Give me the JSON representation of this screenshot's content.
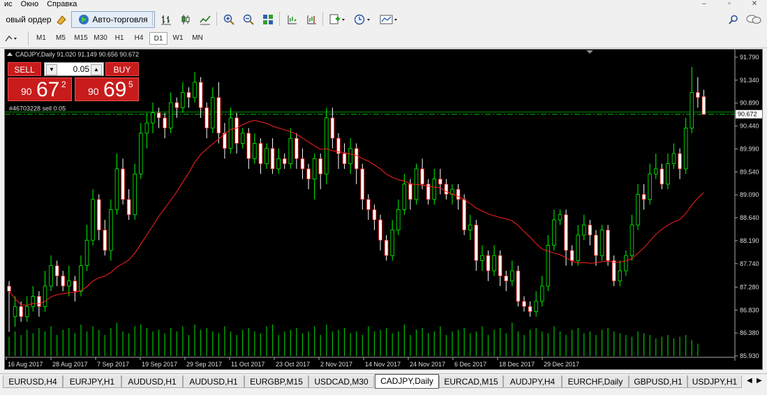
{
  "menu": {
    "items": [
      "ис",
      "Окно",
      "Справка"
    ],
    "win_min": "–",
    "win_restore": "▫",
    "win_close": "✕"
  },
  "toolbar": {
    "new_order_label": "овый ордер",
    "auto_trading_label": "Авто-торговля",
    "timeframes": [
      "M1",
      "M5",
      "M15",
      "M30",
      "H1",
      "H4",
      "D1",
      "W1",
      "MN"
    ],
    "active_timeframe": "D1"
  },
  "chart": {
    "header": "CADJPY,Daily  91.020 91.149 90.656 90.672",
    "order_label": "#46703228 sell 0.05",
    "current_price": "90.672",
    "one_click": {
      "sell_label": "SELL",
      "buy_label": "BUY",
      "lot": "0.05",
      "sell_small": "90",
      "sell_big": "67",
      "sell_sup": "2",
      "buy_small": "90",
      "buy_big": "69",
      "buy_sup": "5"
    }
  },
  "chart_data": {
    "type": "candlestick",
    "symbol": "CADJPY",
    "timeframe": "Daily",
    "price_axis": [
      "91.790",
      "91.340",
      "90.890",
      "90.440",
      "89.990",
      "89.540",
      "89.090",
      "88.640",
      "88.190",
      "87.740",
      "87.280",
      "86.830",
      "86.380",
      "85.930"
    ],
    "ylim": [
      85.93,
      91.79
    ],
    "x_labels": [
      "16 Aug 2017",
      "28 Aug 2017",
      "7 Sep 2017",
      "19 Sep 2017",
      "29 Sep 2017",
      "11 Oct 2017",
      "23 Oct 2017",
      "2 Nov 2017",
      "14 Nov 2017",
      "24 Nov 2017",
      "6 Dec 2017",
      "18 Dec 2017",
      "29 Dec 2017"
    ],
    "current_price": 90.672,
    "order_price": 90.672,
    "candles": [
      [
        87.3,
        87.2,
        87.4,
        86.4
      ],
      [
        86.7,
        86.9,
        87.1,
        86.5
      ],
      [
        86.9,
        86.7,
        87.0,
        86.6
      ],
      [
        86.7,
        86.9,
        87.1,
        86.6
      ],
      [
        86.9,
        87.1,
        87.3,
        86.8
      ],
      [
        87.1,
        86.9,
        87.2,
        86.7
      ],
      [
        86.9,
        87.3,
        87.6,
        86.8
      ],
      [
        87.3,
        87.7,
        87.9,
        87.2
      ],
      [
        87.7,
        87.5,
        87.8,
        87.3
      ],
      [
        87.5,
        87.3,
        87.6,
        87.2
      ],
      [
        87.3,
        87.4,
        87.7,
        87.1
      ],
      [
        87.4,
        87.2,
        87.5,
        87.0
      ],
      [
        87.2,
        87.7,
        87.9,
        87.1
      ],
      [
        87.7,
        88.2,
        88.5,
        87.6
      ],
      [
        88.2,
        89.0,
        89.2,
        88.1
      ],
      [
        89.0,
        88.4,
        89.1,
        88.2
      ],
      [
        88.4,
        88.0,
        88.6,
        87.9
      ],
      [
        88.0,
        88.8,
        89.0,
        87.8
      ],
      [
        88.8,
        89.6,
        89.9,
        88.7
      ],
      [
        89.6,
        89.0,
        89.8,
        88.9
      ],
      [
        89.0,
        88.7,
        89.2,
        88.6
      ],
      [
        88.7,
        89.5,
        89.7,
        88.6
      ],
      [
        89.5,
        90.3,
        90.5,
        89.4
      ],
      [
        90.3,
        90.5,
        90.7,
        90.0
      ],
      [
        90.5,
        90.7,
        90.9,
        90.3
      ],
      [
        90.7,
        90.6,
        90.8,
        90.4
      ],
      [
        90.6,
        90.4,
        90.7,
        90.2
      ],
      [
        90.4,
        90.9,
        91.1,
        90.3
      ],
      [
        90.9,
        90.8,
        91.0,
        90.6
      ],
      [
        90.8,
        91.1,
        91.3,
        90.7
      ],
      [
        91.1,
        91.0,
        91.2,
        90.8
      ],
      [
        91.0,
        91.3,
        91.5,
        90.9
      ],
      [
        91.3,
        90.8,
        91.4,
        90.6
      ],
      [
        90.8,
        90.4,
        90.9,
        90.2
      ],
      [
        90.4,
        91.0,
        91.2,
        90.3
      ],
      [
        91.0,
        90.3,
        91.3,
        90.1
      ],
      [
        90.3,
        90.0,
        90.5,
        89.8
      ],
      [
        90.0,
        90.6,
        90.8,
        89.9
      ],
      [
        90.6,
        90.1,
        90.7,
        89.9
      ],
      [
        90.1,
        90.3,
        90.4,
        90.0
      ],
      [
        90.3,
        89.8,
        90.4,
        89.6
      ],
      [
        89.8,
        90.1,
        90.3,
        89.7
      ],
      [
        90.1,
        89.7,
        90.2,
        89.5
      ],
      [
        89.7,
        90.0,
        90.1,
        89.6
      ],
      [
        90.0,
        89.6,
        90.2,
        89.5
      ],
      [
        89.6,
        89.8,
        90.0,
        89.5
      ],
      [
        89.8,
        89.7,
        89.9,
        89.6
      ],
      [
        89.7,
        90.2,
        90.4,
        89.6
      ],
      [
        90.2,
        89.8,
        90.3,
        89.6
      ],
      [
        89.8,
        89.6,
        90.0,
        89.4
      ],
      [
        89.6,
        89.4,
        89.7,
        89.2
      ],
      [
        89.4,
        89.8,
        89.9,
        89.0
      ],
      [
        89.8,
        89.5,
        89.9,
        89.2
      ],
      [
        89.5,
        90.6,
        90.8,
        89.3
      ],
      [
        90.6,
        90.2,
        90.8,
        90.0
      ],
      [
        90.2,
        89.9,
        90.3,
        89.6
      ],
      [
        89.9,
        89.7,
        90.1,
        89.6
      ],
      [
        89.7,
        90.0,
        90.2,
        89.5
      ],
      [
        90.0,
        89.6,
        90.1,
        89.3
      ],
      [
        89.6,
        89.0,
        89.7,
        88.8
      ],
      [
        89.0,
        88.8,
        89.1,
        88.6
      ],
      [
        88.8,
        88.6,
        88.9,
        88.4
      ],
      [
        88.6,
        88.2,
        88.7,
        88.0
      ],
      [
        88.2,
        87.9,
        88.3,
        87.8
      ],
      [
        87.9,
        88.4,
        88.6,
        87.8
      ],
      [
        88.4,
        88.8,
        89.0,
        88.3
      ],
      [
        88.8,
        89.3,
        89.5,
        88.7
      ],
      [
        89.3,
        89.0,
        89.4,
        88.8
      ],
      [
        89.0,
        89.6,
        89.7,
        88.9
      ],
      [
        89.6,
        89.3,
        89.8,
        89.2
      ],
      [
        89.3,
        89.0,
        89.4,
        88.9
      ],
      [
        89.0,
        89.4,
        89.6,
        88.9
      ],
      [
        89.4,
        89.3,
        89.6,
        89.1
      ],
      [
        89.3,
        89.1,
        89.4,
        89.0
      ],
      [
        89.1,
        89.2,
        89.3,
        88.9
      ],
      [
        89.2,
        89.0,
        89.3,
        88.8
      ],
      [
        89.0,
        88.4,
        89.1,
        88.3
      ],
      [
        88.4,
        88.5,
        88.7,
        88.2
      ],
      [
        88.5,
        87.8,
        88.6,
        87.6
      ],
      [
        87.8,
        87.9,
        88.1,
        87.6
      ],
      [
        87.9,
        87.6,
        88.0,
        87.4
      ],
      [
        87.6,
        87.9,
        88.1,
        87.5
      ],
      [
        87.9,
        87.5,
        88.0,
        87.3
      ],
      [
        87.5,
        87.4,
        87.6,
        87.2
      ],
      [
        87.4,
        87.6,
        87.8,
        87.3
      ],
      [
        87.6,
        87.0,
        87.7,
        86.9
      ],
      [
        87.0,
        86.9,
        87.1,
        86.8
      ],
      [
        86.9,
        86.8,
        87.0,
        86.7
      ],
      [
        86.8,
        87.0,
        87.2,
        86.7
      ],
      [
        87.0,
        87.3,
        87.5,
        86.9
      ],
      [
        87.3,
        88.1,
        88.3,
        87.2
      ],
      [
        88.1,
        88.6,
        88.8,
        88.0
      ],
      [
        88.6,
        88.7,
        88.8,
        88.5
      ],
      [
        88.7,
        88.0,
        88.8,
        87.7
      ],
      [
        88.0,
        87.8,
        88.1,
        87.7
      ],
      [
        87.8,
        88.3,
        88.5,
        87.7
      ],
      [
        88.3,
        88.5,
        88.7,
        88.2
      ],
      [
        88.5,
        88.3,
        88.6,
        88.1
      ],
      [
        88.3,
        87.9,
        88.4,
        87.7
      ],
      [
        87.9,
        88.4,
        88.5,
        87.8
      ],
      [
        88.4,
        87.8,
        88.5,
        87.7
      ],
      [
        87.8,
        87.4,
        87.9,
        87.3
      ],
      [
        87.4,
        87.6,
        87.8,
        87.3
      ],
      [
        87.6,
        87.9,
        88.0,
        87.5
      ],
      [
        87.9,
        88.5,
        88.7,
        87.8
      ],
      [
        88.5,
        89.1,
        89.3,
        88.4
      ],
      [
        89.1,
        89.0,
        89.3,
        88.8
      ],
      [
        89.0,
        89.5,
        89.7,
        88.9
      ],
      [
        89.5,
        89.6,
        89.9,
        89.4
      ],
      [
        89.6,
        89.3,
        89.7,
        89.2
      ],
      [
        89.3,
        89.7,
        89.9,
        89.2
      ],
      [
        89.7,
        89.9,
        90.1,
        89.6
      ],
      [
        89.9,
        89.6,
        90.0,
        89.4
      ],
      [
        89.6,
        90.4,
        90.6,
        89.5
      ],
      [
        90.4,
        91.1,
        91.6,
        90.3
      ],
      [
        91.1,
        91.0,
        91.4,
        90.8
      ],
      [
        91.02,
        90.67,
        91.15,
        90.66
      ]
    ],
    "volumes": [
      0.55,
      0.7,
      0.6,
      0.75,
      0.65,
      0.8,
      0.7,
      0.85,
      0.6,
      0.75,
      0.8,
      0.65,
      0.9,
      0.7,
      0.85,
      0.75,
      0.6,
      0.8,
      0.95,
      0.7,
      0.65,
      0.85,
      0.9,
      0.8,
      0.7,
      0.75,
      0.65,
      0.8,
      0.7,
      0.85,
      0.6,
      0.9,
      0.75,
      0.8,
      0.7,
      0.65,
      0.85,
      0.7,
      0.6,
      0.75,
      0.8,
      0.7,
      0.65,
      0.85,
      0.9,
      0.6,
      0.7,
      0.75,
      0.8,
      0.65,
      0.7,
      0.85,
      0.6,
      0.9,
      0.7,
      0.75,
      0.8,
      0.65,
      0.7,
      0.6,
      0.85,
      0.7,
      0.75,
      0.8,
      0.65,
      0.7,
      0.9,
      0.6,
      0.75,
      0.8,
      0.65,
      0.7,
      0.85,
      0.6,
      0.7,
      0.75,
      0.8,
      0.65,
      0.7,
      0.85,
      0.6,
      0.75,
      0.8,
      0.65,
      0.95,
      0.7,
      0.6,
      0.75,
      0.8,
      0.7,
      0.65,
      0.85,
      0.7,
      0.6,
      0.75,
      0.8,
      0.65,
      0.7,
      0.6,
      0.75,
      0.8,
      0.7,
      0.65,
      0.6,
      0.55,
      0.7,
      0.65,
      0.6,
      0.5,
      0.55,
      0.6,
      0.5,
      0.55,
      0.6,
      0.45,
      0.35
    ]
  },
  "tabs": [
    {
      "label": "EURUSD,H4"
    },
    {
      "label": "EURJPY,H1"
    },
    {
      "label": "AUDUSD,H1"
    },
    {
      "label": "AUDUSD,H1"
    },
    {
      "label": "EURGBP,M15"
    },
    {
      "label": "USDCAD,M30"
    },
    {
      "label": "CADJPY,Daily"
    },
    {
      "label": "EURCAD,M15"
    },
    {
      "label": "AUDJPY,H4"
    },
    {
      "label": "EURCHF,Daily"
    },
    {
      "label": "GBPUSD,H1"
    },
    {
      "label": "USDJPY,H1"
    }
  ],
  "active_tab": "CADJPY,Daily",
  "colors": {
    "bull": "#00ff00",
    "bear": "#ffffff",
    "ma": "#ff2020",
    "order_line": "#00c000",
    "volume": "#00c000",
    "chart_bg": "#000000",
    "sell_button": "#c81c1c"
  }
}
